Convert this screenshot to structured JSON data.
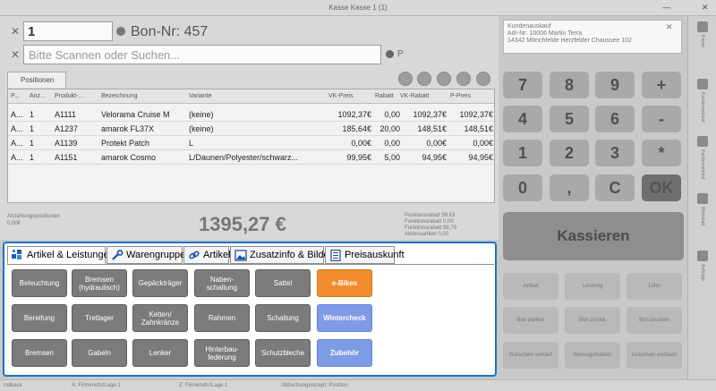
{
  "window": {
    "title": "Kasse Kasse 1 (1)",
    "min": "—",
    "close": "✕"
  },
  "entry": {
    "quantity": "1",
    "bon_label": "Bon-Nr: 457",
    "search_placeholder": "Bitte Scannen oder Suchen...",
    "clear": "✕",
    "search_key": "P"
  },
  "positions": {
    "tab_label": "Positionen",
    "columns": [
      "P...",
      "Anz...",
      "Produkt-...",
      "Bezeichnung",
      "Variante",
      "VK-Preis",
      "Rabatt",
      "VK-Rabatt",
      "P-Preis"
    ],
    "rows": [
      [
        "A...",
        "1",
        "A1111",
        "Velorama Cruise M",
        "(keine)",
        "1092,37€",
        "0,00",
        "1092,37€",
        "1092,37€"
      ],
      [
        "A...",
        "1",
        "A1237",
        "amarok FL37X",
        "(keine)",
        "185,64€",
        "20,00",
        "148,51€",
        "148,51€"
      ],
      [
        "A...",
        "1",
        "A1139",
        "Protekt Patch",
        "L",
        "0,00€",
        "0,00",
        "0,00€",
        "0,00€"
      ],
      [
        "A...",
        "1",
        "A1151",
        "amarok Cosmo",
        "L/Daunen/Polyester/schwarz...",
        "99,95€",
        "5,00",
        "94,95€",
        "94,95€"
      ]
    ]
  },
  "summary": {
    "left_label": "Anzahlungspositionen",
    "left_value": "0,00€",
    "total": "1395,27 €",
    "right": [
      "Positionsrabatt 98,63",
      "Funktionsrabatt 0,00",
      "Funktionsrabatt 98,79",
      "Aktionsartikel 0,00"
    ]
  },
  "customer": {
    "line1": "Kundenauskauf",
    "line2": "Adr-Nr: 10006 Martin Terra",
    "line3": "14342 Mönchfelde Herzfelder Chaussee 102",
    "close": "✕"
  },
  "keypad": [
    "7",
    "8",
    "9",
    "+",
    "4",
    "5",
    "6",
    "-",
    "1",
    "2",
    "3",
    "*",
    "0",
    ",",
    "C",
    "OK"
  ],
  "kassieren": "Kassieren",
  "function_buttons": [
    "Artikel",
    "Leistung",
    "Lohn",
    "Bon parken",
    "Bon zurück",
    "Bon drucken",
    "Gutschein verkauf",
    "Bonusguthaben",
    "Gutschein einlösen"
  ],
  "sidebar": [
    "Kasse",
    "Kundenverkauf",
    "Kundenverkauf",
    "Werkstatt",
    "Aufträge"
  ],
  "status": [
    "rollback",
    "A: Firmenuhr/Lage 1",
    "Z: Firmenuhr/Lage 1",
    "Abbuchungsrezept: Position"
  ],
  "panel": {
    "tabs": [
      "Artikel & Leistungen",
      "Warengruppen",
      "Artikel",
      "Zusatzinfo & Bilder",
      "Preisauskunft"
    ],
    "buttons": [
      [
        "Beleuchtung",
        "Bremsen (hydraulisch)",
        "Gepäckträger",
        "Naben-\nschaltung",
        "Sattel",
        "e-Bikes"
      ],
      [
        "Bereifung",
        "Tretlager",
        "Ketten/\nZahnkränze",
        "Rahmen",
        "Schaltung",
        "Wintercheck"
      ],
      [
        "Bremsen",
        "Gabeln",
        "Lenker",
        "Hinterbau-\nfederung",
        "Schutzbleche",
        "Zubehör"
      ]
    ],
    "colors": {
      "accent": "#1a73c8",
      "gray": "#7b7b7b",
      "orange": "#f28c2e",
      "blue": "#7e9ce6"
    }
  }
}
